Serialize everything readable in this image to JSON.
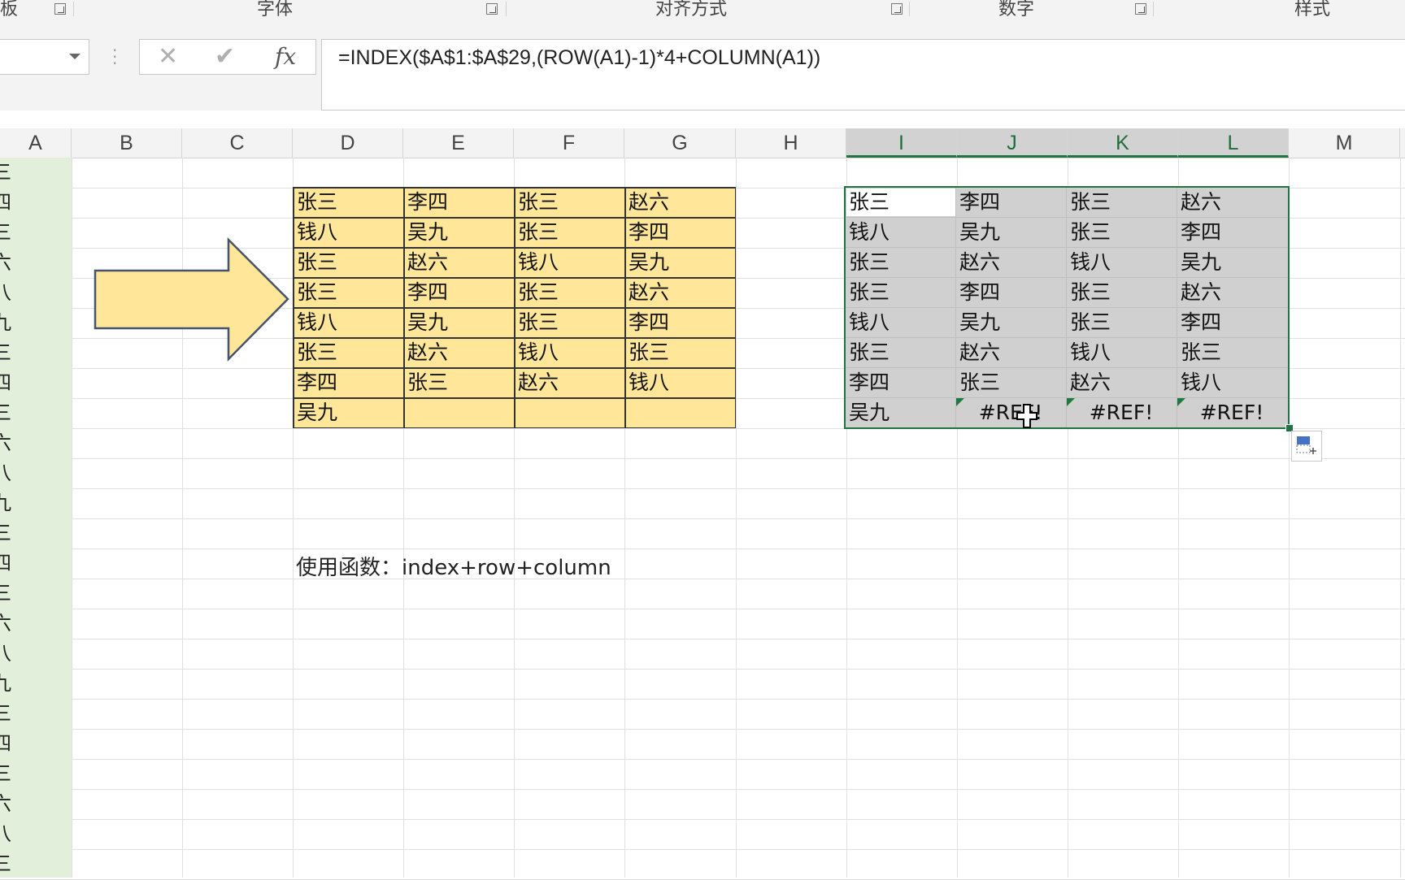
{
  "ribbon": {
    "groups": [
      "字体",
      "对齐方式",
      "数字",
      "样式"
    ],
    "left_fragment": "板"
  },
  "formula_bar": {
    "cancel_icon": "✕",
    "enter_icon": "✔",
    "fx_label": "fx",
    "formula": "=INDEX($A$1:$A$29,(ROW(A1)-1)*4+COLUMN(A1))"
  },
  "columns": [
    "A",
    "B",
    "C",
    "D",
    "E",
    "F",
    "G",
    "H",
    "I",
    "J",
    "K",
    "L",
    "M"
  ],
  "selected_columns": [
    "I",
    "J",
    "K",
    "L"
  ],
  "column_a_fragments": [
    "三",
    "四",
    "三",
    "六",
    "八",
    "九",
    "三",
    "四",
    "三",
    "六",
    "八",
    "九",
    "三",
    "四",
    "三",
    "六",
    "八",
    "九",
    "三",
    "四",
    "三",
    "六",
    "八",
    "三"
  ],
  "source_table": {
    "rows": [
      [
        "张三",
        "李四",
        "张三",
        "赵六"
      ],
      [
        "钱八",
        "吴九",
        "张三",
        "李四"
      ],
      [
        "张三",
        "赵六",
        "钱八",
        "吴九"
      ],
      [
        "张三",
        "李四",
        "张三",
        "赵六"
      ],
      [
        "钱八",
        "吴九",
        "张三",
        "李四"
      ],
      [
        "张三",
        "赵六",
        "钱八",
        "张三"
      ],
      [
        "李四",
        "张三",
        "赵六",
        "钱八"
      ],
      [
        "吴九",
        "",
        "",
        ""
      ]
    ]
  },
  "result_table": {
    "rows": [
      [
        "张三",
        "李四",
        "张三",
        "赵六"
      ],
      [
        "钱八",
        "吴九",
        "张三",
        "李四"
      ],
      [
        "张三",
        "赵六",
        "钱八",
        "吴九"
      ],
      [
        "张三",
        "李四",
        "张三",
        "赵六"
      ],
      [
        "钱八",
        "吴九",
        "张三",
        "李四"
      ],
      [
        "张三",
        "赵六",
        "钱八",
        "张三"
      ],
      [
        "李四",
        "张三",
        "赵六",
        "钱八"
      ],
      [
        "吴九",
        "#REF!",
        "#REF!",
        "#REF!"
      ]
    ]
  },
  "note": "使用函数：index+row+column",
  "colors": {
    "source_fill": "#ffe699",
    "selection_fill": "#d0d0d0",
    "selection_border": "#217346",
    "column_a_fill": "#e2efda",
    "arrow_fill": "#ffe699",
    "arrow_stroke": "#44546a"
  }
}
